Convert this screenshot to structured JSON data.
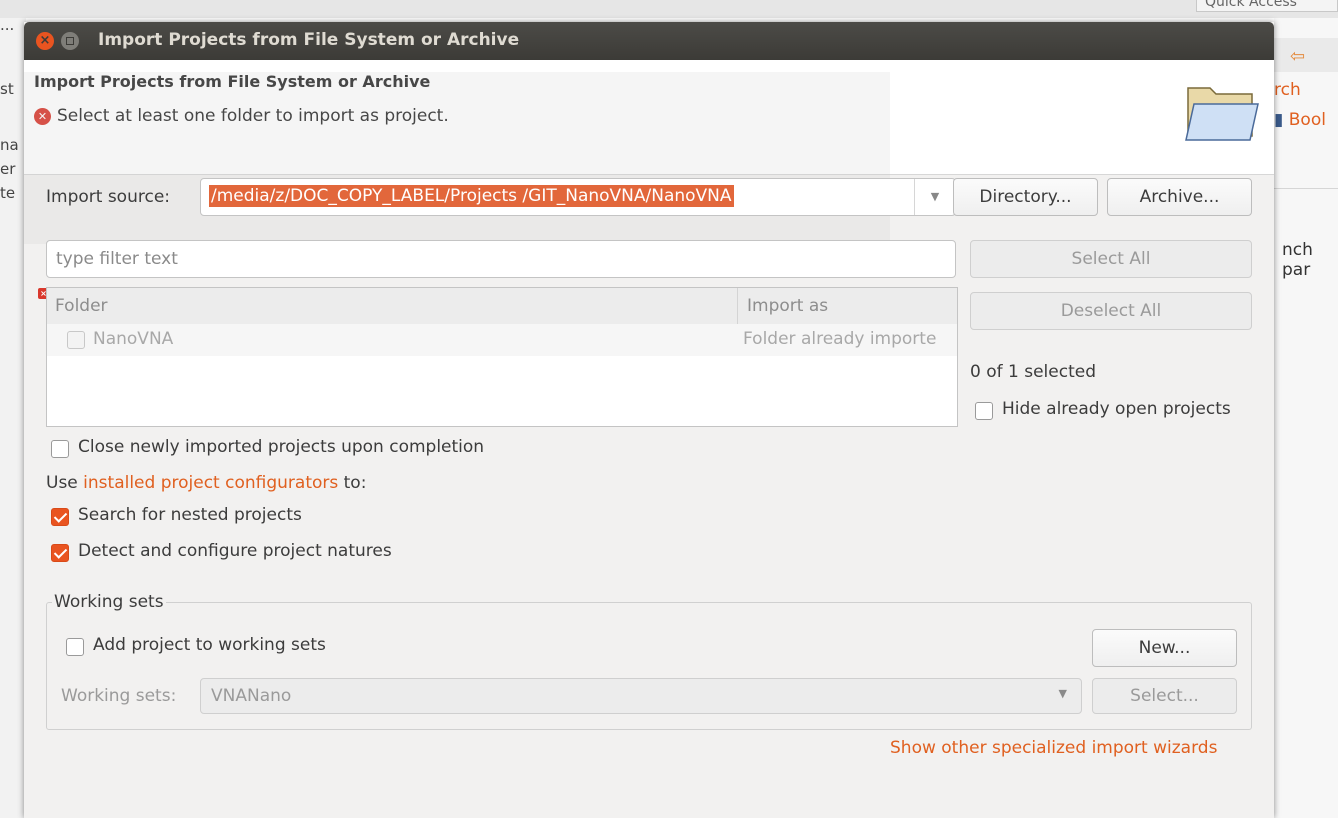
{
  "background": {
    "quick_access": "Quick Access",
    "left_fragments": [
      "...",
      "st",
      "na",
      "er",
      "te"
    ],
    "right_link_1": "rch",
    "right_link_2": "Bool",
    "right_text": "nch par"
  },
  "dialog": {
    "window_title": "Import Projects from File System or Archive",
    "header_title": "Import Projects from File System or Archive",
    "error_message": "Select at least one folder to import as project.",
    "import_source_label": "Import source:",
    "import_source_value": "/media/z/DOC_COPY_LABEL/Projects /GIT_NanoVNA/NanoVNA",
    "directory_button": "Directory...",
    "archive_button": "Archive...",
    "filter_placeholder": "type filter text",
    "select_all_button": "Select All",
    "deselect_all_button": "Deselect All",
    "table": {
      "columns": [
        "Folder",
        "Import as"
      ],
      "rows": [
        {
          "folder": "NanoVNA",
          "import_as": "Folder already importe",
          "checked": false,
          "enabled": false
        }
      ]
    },
    "selection_count": "0 of 1 selected",
    "hide_open_label": "Hide already open projects",
    "hide_open_checked": false,
    "close_imported_label": "Close newly imported projects upon completion",
    "close_imported_checked": false,
    "use_prefix": "Use",
    "configurators_link": "installed project configurators",
    "use_suffix": "to:",
    "search_nested_label": "Search for nested projects",
    "search_nested_checked": true,
    "detect_natures_label": "Detect and configure project natures",
    "detect_natures_checked": true,
    "working_sets": {
      "group_title": "Working sets",
      "add_label": "Add project to working sets",
      "add_checked": false,
      "new_button": "New...",
      "combo_label": "Working sets:",
      "combo_value": "VNANano",
      "select_button": "Select..."
    },
    "other_wizards_link": "Show other specialized import wizards"
  },
  "colors": {
    "accent": "#e95420",
    "link": "#e06020",
    "error": "#d9382c",
    "titlebar": "#3c3b37"
  }
}
